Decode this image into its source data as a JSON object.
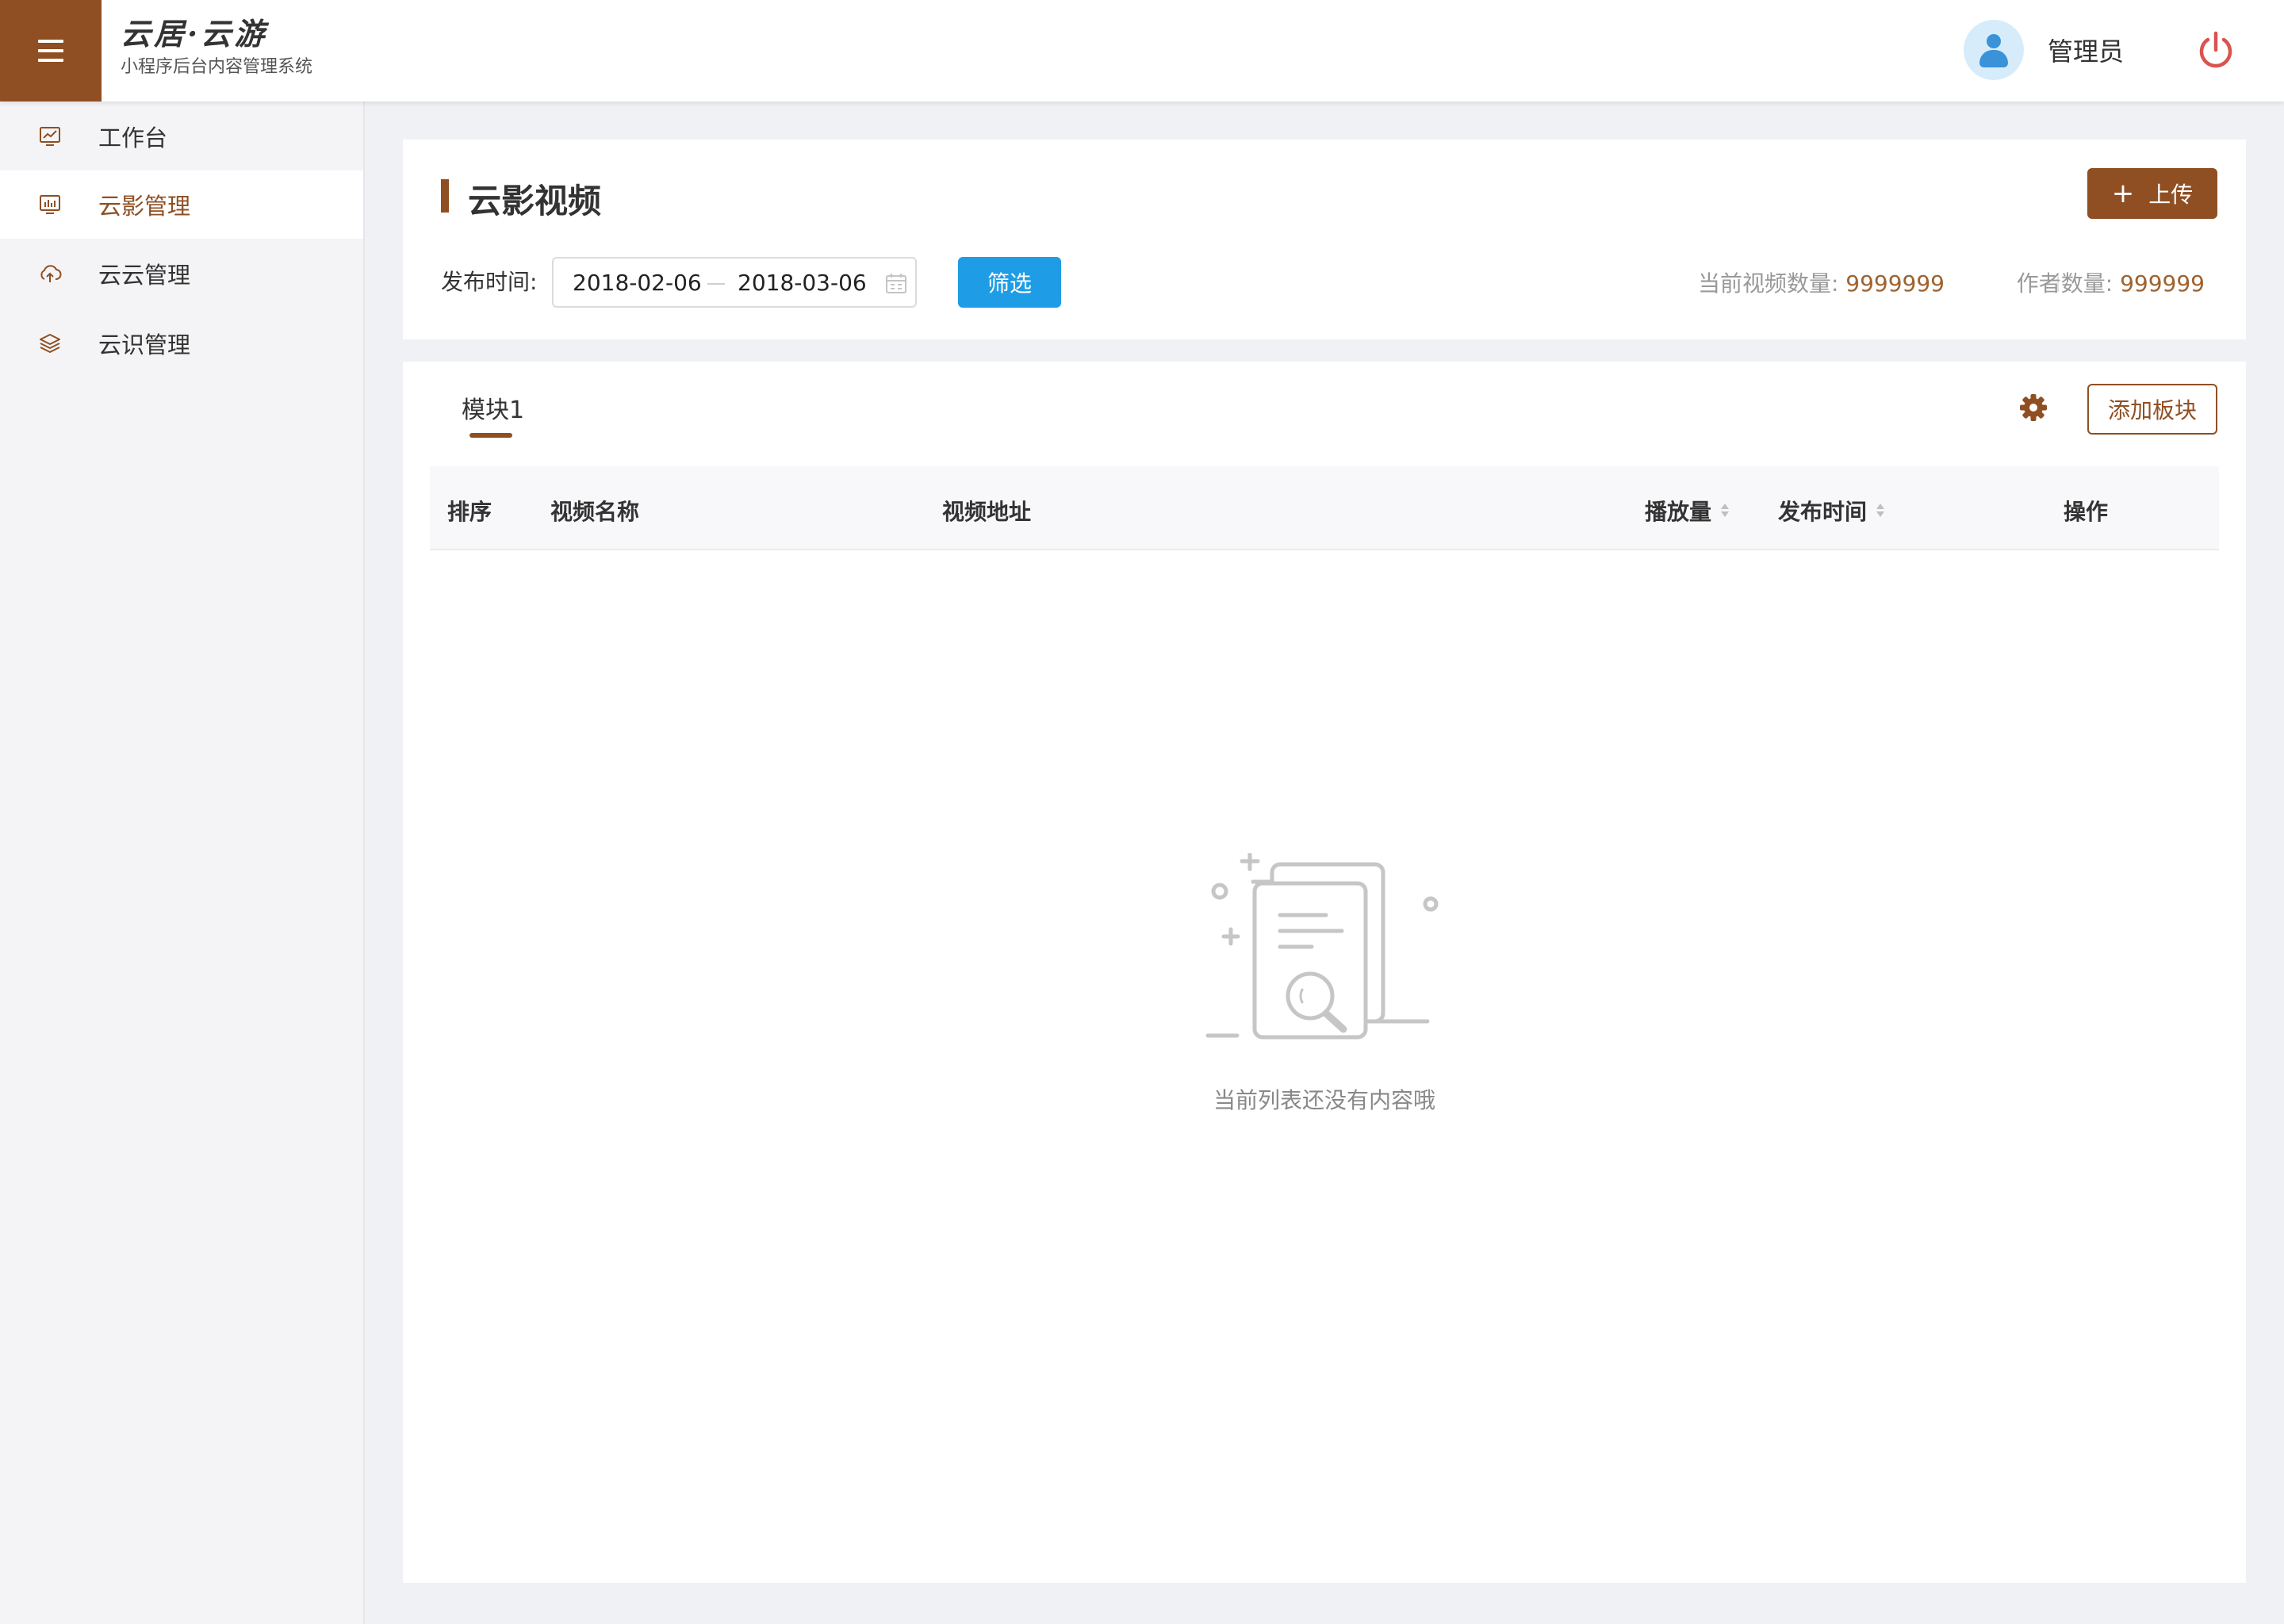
{
  "header": {
    "brand_name": "云居·云游",
    "brand_subtitle": "小程序后台内容管理系统",
    "user_name": "管理员"
  },
  "sidebar": {
    "items": [
      {
        "label": "工作台",
        "icon": "chart-monitor-icon",
        "active": false
      },
      {
        "label": "云影管理",
        "icon": "bar-chart-monitor-icon",
        "active": true
      },
      {
        "label": "云云管理",
        "icon": "cloud-upload-icon",
        "active": false
      },
      {
        "label": "云识管理",
        "icon": "layers-icon",
        "active": false
      }
    ]
  },
  "page": {
    "title": "云影视频",
    "upload_label": "上传",
    "filter": {
      "label": "发布时间:",
      "start_date": "2018-02-06",
      "end_date": "2018-03-06",
      "button_label": "筛选"
    },
    "stats": {
      "video_count_label": "当前视频数量:",
      "video_count": "9999999",
      "author_count_label": "作者数量:",
      "author_count": "999999"
    }
  },
  "module": {
    "tab_label": "模块1",
    "add_block_label": "添加板块",
    "columns": [
      "排序",
      "视频名称",
      "视频地址",
      "播放量",
      "发布时间",
      "操作"
    ],
    "rows": [],
    "empty_text": "当前列表还没有内容哦"
  },
  "colors": {
    "brand": "#8f4f22",
    "primary_button": "#1e9de6",
    "stat_value": "#a0622f",
    "power_icon": "#d9534f"
  }
}
